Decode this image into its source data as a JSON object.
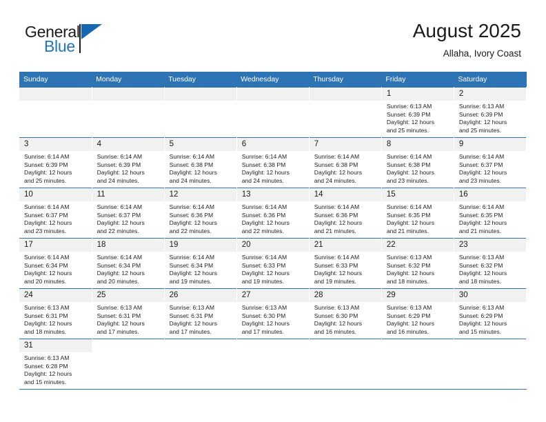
{
  "brand": {
    "name_part1": "General",
    "name_part2": "Blue",
    "logo_icon": "flag-triangle-icon"
  },
  "header": {
    "title": "August 2025",
    "subtitle": "Allaha, Ivory Coast"
  },
  "calendar": {
    "weekday_headers": [
      "Sunday",
      "Monday",
      "Tuesday",
      "Wednesday",
      "Thursday",
      "Friday",
      "Saturday"
    ],
    "colors": {
      "header_background": "#2e74b5",
      "header_text": "#ffffff",
      "daynum_background": "#f1f1f1",
      "grid_line": "#2e74b5",
      "brand_blue": "#2175bc"
    },
    "weeks": [
      [
        {
          "day": "",
          "blank": true
        },
        {
          "day": "",
          "blank": true
        },
        {
          "day": "",
          "blank": true
        },
        {
          "day": "",
          "blank": true
        },
        {
          "day": "",
          "blank": true
        },
        {
          "day": "1",
          "sunrise": "Sunrise: 6:13 AM",
          "sunset": "Sunset: 6:39 PM",
          "daylight1": "Daylight: 12 hours",
          "daylight2": "and 25 minutes."
        },
        {
          "day": "2",
          "sunrise": "Sunrise: 6:13 AM",
          "sunset": "Sunset: 6:39 PM",
          "daylight1": "Daylight: 12 hours",
          "daylight2": "and 25 minutes."
        }
      ],
      [
        {
          "day": "3",
          "sunrise": "Sunrise: 6:14 AM",
          "sunset": "Sunset: 6:39 PM",
          "daylight1": "Daylight: 12 hours",
          "daylight2": "and 25 minutes."
        },
        {
          "day": "4",
          "sunrise": "Sunrise: 6:14 AM",
          "sunset": "Sunset: 6:39 PM",
          "daylight1": "Daylight: 12 hours",
          "daylight2": "and 24 minutes."
        },
        {
          "day": "5",
          "sunrise": "Sunrise: 6:14 AM",
          "sunset": "Sunset: 6:38 PM",
          "daylight1": "Daylight: 12 hours",
          "daylight2": "and 24 minutes."
        },
        {
          "day": "6",
          "sunrise": "Sunrise: 6:14 AM",
          "sunset": "Sunset: 6:38 PM",
          "daylight1": "Daylight: 12 hours",
          "daylight2": "and 24 minutes."
        },
        {
          "day": "7",
          "sunrise": "Sunrise: 6:14 AM",
          "sunset": "Sunset: 6:38 PM",
          "daylight1": "Daylight: 12 hours",
          "daylight2": "and 24 minutes."
        },
        {
          "day": "8",
          "sunrise": "Sunrise: 6:14 AM",
          "sunset": "Sunset: 6:38 PM",
          "daylight1": "Daylight: 12 hours",
          "daylight2": "and 23 minutes."
        },
        {
          "day": "9",
          "sunrise": "Sunrise: 6:14 AM",
          "sunset": "Sunset: 6:37 PM",
          "daylight1": "Daylight: 12 hours",
          "daylight2": "and 23 minutes."
        }
      ],
      [
        {
          "day": "10",
          "sunrise": "Sunrise: 6:14 AM",
          "sunset": "Sunset: 6:37 PM",
          "daylight1": "Daylight: 12 hours",
          "daylight2": "and 23 minutes."
        },
        {
          "day": "11",
          "sunrise": "Sunrise: 6:14 AM",
          "sunset": "Sunset: 6:37 PM",
          "daylight1": "Daylight: 12 hours",
          "daylight2": "and 22 minutes."
        },
        {
          "day": "12",
          "sunrise": "Sunrise: 6:14 AM",
          "sunset": "Sunset: 6:36 PM",
          "daylight1": "Daylight: 12 hours",
          "daylight2": "and 22 minutes."
        },
        {
          "day": "13",
          "sunrise": "Sunrise: 6:14 AM",
          "sunset": "Sunset: 6:36 PM",
          "daylight1": "Daylight: 12 hours",
          "daylight2": "and 22 minutes."
        },
        {
          "day": "14",
          "sunrise": "Sunrise: 6:14 AM",
          "sunset": "Sunset: 6:36 PM",
          "daylight1": "Daylight: 12 hours",
          "daylight2": "and 21 minutes."
        },
        {
          "day": "15",
          "sunrise": "Sunrise: 6:14 AM",
          "sunset": "Sunset: 6:35 PM",
          "daylight1": "Daylight: 12 hours",
          "daylight2": "and 21 minutes."
        },
        {
          "day": "16",
          "sunrise": "Sunrise: 6:14 AM",
          "sunset": "Sunset: 6:35 PM",
          "daylight1": "Daylight: 12 hours",
          "daylight2": "and 21 minutes."
        }
      ],
      [
        {
          "day": "17",
          "sunrise": "Sunrise: 6:14 AM",
          "sunset": "Sunset: 6:34 PM",
          "daylight1": "Daylight: 12 hours",
          "daylight2": "and 20 minutes."
        },
        {
          "day": "18",
          "sunrise": "Sunrise: 6:14 AM",
          "sunset": "Sunset: 6:34 PM",
          "daylight1": "Daylight: 12 hours",
          "daylight2": "and 20 minutes."
        },
        {
          "day": "19",
          "sunrise": "Sunrise: 6:14 AM",
          "sunset": "Sunset: 6:34 PM",
          "daylight1": "Daylight: 12 hours",
          "daylight2": "and 19 minutes."
        },
        {
          "day": "20",
          "sunrise": "Sunrise: 6:14 AM",
          "sunset": "Sunset: 6:33 PM",
          "daylight1": "Daylight: 12 hours",
          "daylight2": "and 19 minutes."
        },
        {
          "day": "21",
          "sunrise": "Sunrise: 6:14 AM",
          "sunset": "Sunset: 6:33 PM",
          "daylight1": "Daylight: 12 hours",
          "daylight2": "and 19 minutes."
        },
        {
          "day": "22",
          "sunrise": "Sunrise: 6:13 AM",
          "sunset": "Sunset: 6:32 PM",
          "daylight1": "Daylight: 12 hours",
          "daylight2": "and 18 minutes."
        },
        {
          "day": "23",
          "sunrise": "Sunrise: 6:13 AM",
          "sunset": "Sunset: 6:32 PM",
          "daylight1": "Daylight: 12 hours",
          "daylight2": "and 18 minutes."
        }
      ],
      [
        {
          "day": "24",
          "sunrise": "Sunrise: 6:13 AM",
          "sunset": "Sunset: 6:31 PM",
          "daylight1": "Daylight: 12 hours",
          "daylight2": "and 18 minutes."
        },
        {
          "day": "25",
          "sunrise": "Sunrise: 6:13 AM",
          "sunset": "Sunset: 6:31 PM",
          "daylight1": "Daylight: 12 hours",
          "daylight2": "and 17 minutes."
        },
        {
          "day": "26",
          "sunrise": "Sunrise: 6:13 AM",
          "sunset": "Sunset: 6:31 PM",
          "daylight1": "Daylight: 12 hours",
          "daylight2": "and 17 minutes."
        },
        {
          "day": "27",
          "sunrise": "Sunrise: 6:13 AM",
          "sunset": "Sunset: 6:30 PM",
          "daylight1": "Daylight: 12 hours",
          "daylight2": "and 17 minutes."
        },
        {
          "day": "28",
          "sunrise": "Sunrise: 6:13 AM",
          "sunset": "Sunset: 6:30 PM",
          "daylight1": "Daylight: 12 hours",
          "daylight2": "and 16 minutes."
        },
        {
          "day": "29",
          "sunrise": "Sunrise: 6:13 AM",
          "sunset": "Sunset: 6:29 PM",
          "daylight1": "Daylight: 12 hours",
          "daylight2": "and 16 minutes."
        },
        {
          "day": "30",
          "sunrise": "Sunrise: 6:13 AM",
          "sunset": "Sunset: 6:29 PM",
          "daylight1": "Daylight: 12 hours",
          "daylight2": "and 15 minutes."
        }
      ],
      [
        {
          "day": "31",
          "sunrise": "Sunrise: 6:13 AM",
          "sunset": "Sunset: 6:28 PM",
          "daylight1": "Daylight: 12 hours",
          "daylight2": "and 15 minutes."
        },
        {
          "day": "",
          "blank": true
        },
        {
          "day": "",
          "blank": true
        },
        {
          "day": "",
          "blank": true
        },
        {
          "day": "",
          "blank": true
        },
        {
          "day": "",
          "blank": true
        },
        {
          "day": "",
          "blank": true
        }
      ]
    ]
  }
}
